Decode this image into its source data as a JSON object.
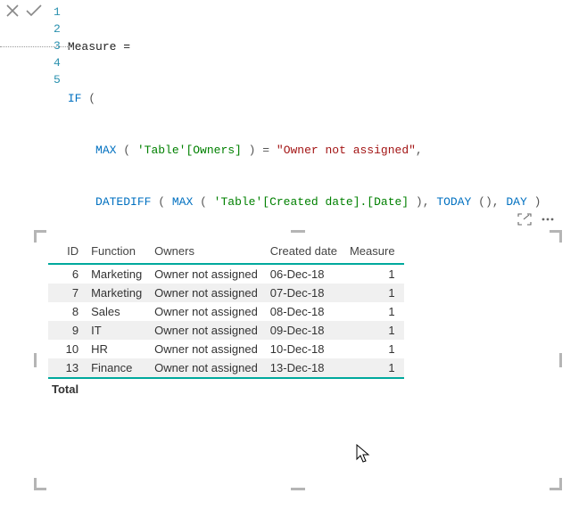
{
  "formula": {
    "line_numbers": [
      "1",
      "2",
      "3",
      "4",
      "5"
    ],
    "l1_a": "Measure =",
    "l2_a": "IF",
    "l2_b": " (",
    "l3_a": "MAX",
    "l3_b": " ( ",
    "l3_c": "'Table'[Owners]",
    "l3_d": " ) = ",
    "l3_e": "\"Owner not assigned\"",
    "l3_f": ",",
    "l4_a": "DATEDIFF",
    "l4_b": " ( ",
    "l4_c": "MAX",
    "l4_d": " ( ",
    "l4_e": "'Table'[Created date].[Date]",
    "l4_f": " ), ",
    "l4_g": "TODAY",
    "l4_h": " (), ",
    "l4_i": "DAY",
    "l4_j": " )",
    "l5_a": ")"
  },
  "chart_data": {
    "type": "table",
    "columns": [
      "ID",
      "Function",
      "Owners",
      "Created date",
      "Measure"
    ],
    "rows": [
      {
        "id": "6",
        "function": "Marketing",
        "owners": "Owner not assigned",
        "created": "06-Dec-18",
        "measure": "1"
      },
      {
        "id": "7",
        "function": "Marketing",
        "owners": "Owner not assigned",
        "created": "07-Dec-18",
        "measure": "1"
      },
      {
        "id": "8",
        "function": "Sales",
        "owners": "Owner not assigned",
        "created": "08-Dec-18",
        "measure": "1"
      },
      {
        "id": "9",
        "function": "IT",
        "owners": "Owner not assigned",
        "created": "09-Dec-18",
        "measure": "1"
      },
      {
        "id": "10",
        "function": "HR",
        "owners": "Owner not assigned",
        "created": "10-Dec-18",
        "measure": "1"
      },
      {
        "id": "13",
        "function": "Finance",
        "owners": "Owner not assigned",
        "created": "13-Dec-18",
        "measure": "1"
      }
    ],
    "total_label": "Total"
  }
}
